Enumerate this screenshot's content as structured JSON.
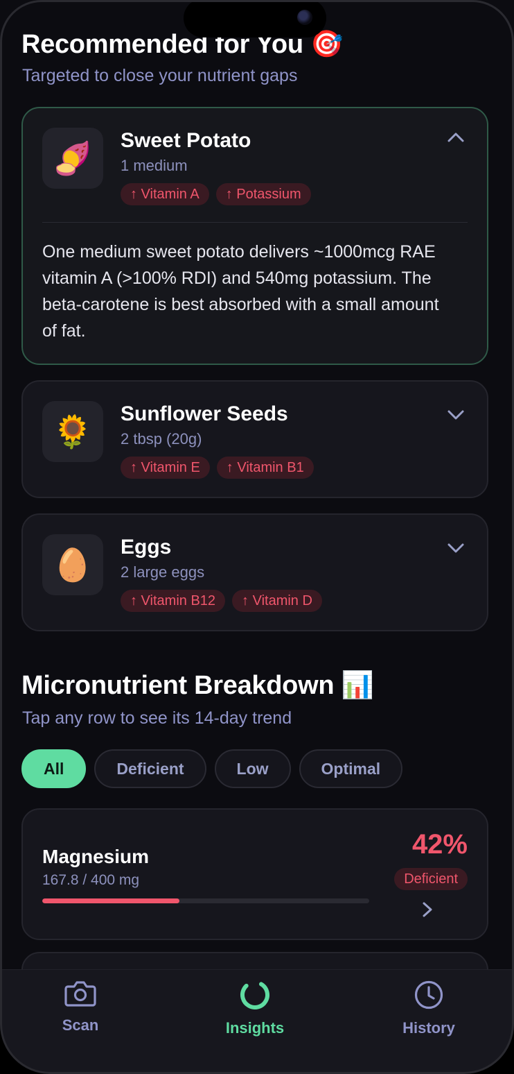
{
  "recommended": {
    "title": "Recommended for You 🎯",
    "subtitle": "Targeted to close your nutrient gaps",
    "items": [
      {
        "emoji": "🍠",
        "name": "Sweet Potato",
        "serving": "1 medium",
        "tags": [
          "↑ Vitamin A",
          "↑ Potassium"
        ],
        "expanded": true,
        "description": "One medium sweet potato delivers ~1000mcg RAE vitamin A (>100% RDI) and 540mg potassium. The beta-carotene is best absorbed with a small amount of fat."
      },
      {
        "emoji": "🌻",
        "name": "Sunflower Seeds",
        "serving": "2 tbsp (20g)",
        "tags": [
          "↑ Vitamin E",
          "↑ Vitamin B1"
        ],
        "expanded": false
      },
      {
        "emoji": "🥚",
        "name": "Eggs",
        "serving": "2 large eggs",
        "tags": [
          "↑ Vitamin B12",
          "↑ Vitamin D"
        ],
        "expanded": false
      }
    ]
  },
  "breakdown": {
    "title": "Micronutrient Breakdown 📊",
    "subtitle": "Tap any row to see its 14-day trend",
    "filters": [
      "All",
      "Deficient",
      "Low",
      "Optimal"
    ],
    "active_filter": "All",
    "rows": [
      {
        "name": "Magnesium",
        "amount": "167.8 / 400 mg",
        "percent_label": "42%",
        "percent": 0.42,
        "status": "Deficient"
      }
    ]
  },
  "tabbar": {
    "tabs": [
      {
        "label": "Scan",
        "icon": "camera-icon"
      },
      {
        "label": "Insights",
        "icon": "ring-icon"
      },
      {
        "label": "History",
        "icon": "clock-icon"
      }
    ],
    "active": "Insights"
  },
  "colors": {
    "accent": "#5fdca1",
    "deficient": "#f0566c",
    "muted": "#9094c9"
  }
}
